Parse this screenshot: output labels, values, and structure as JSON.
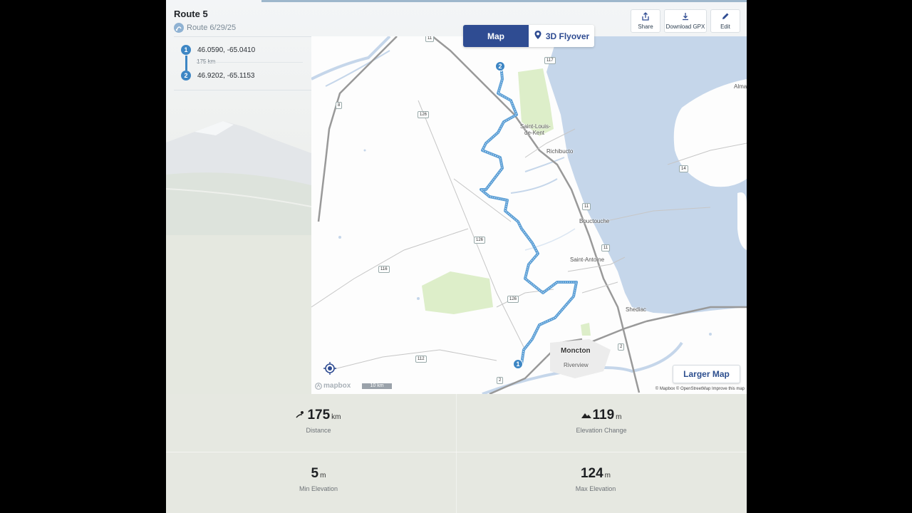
{
  "route": {
    "title": "Route 5",
    "subtitle": "Route 6/29/25"
  },
  "waypoints": [
    {
      "number": "1",
      "coord": "46.0590, -65.0410"
    },
    {
      "number": "2",
      "coord": "46.9202, -65.1153"
    }
  ],
  "segment_distance": "175 km",
  "view_toggle": {
    "map_label": "Map",
    "flyover_label": "3D Flyover",
    "active": "Map"
  },
  "actions": {
    "share": "Share",
    "download": "Download GPX",
    "edit": "Edit"
  },
  "map": {
    "places": {
      "saint_louis_1": "Saint-Louis-",
      "saint_louis_2": "de-Kent",
      "richibucto": "Richibucto",
      "bouctouche": "Bouctouche",
      "saint_antoine": "Saint-Antoine",
      "shediac": "Shediac",
      "moncton": "Moncton",
      "riverview": "Riverview",
      "alma": "Alma"
    },
    "shields": [
      "11",
      "117",
      "8",
      "126",
      "14",
      "11",
      "11",
      "126",
      "116",
      "126",
      "2",
      "112",
      "2"
    ],
    "logo": "mapbox",
    "scale": "10 km",
    "attribution": "© Mapbox © OpenStreetMap  Improve this map",
    "larger_map": "Larger Map",
    "colors": {
      "water": "#c5d6ea",
      "park": "#ddeec9",
      "route": "#5c9fd6",
      "pin": "#3d86c4"
    }
  },
  "stats": {
    "distance": {
      "value": "175",
      "unit": "km",
      "label": "Distance"
    },
    "elevation_change": {
      "value": "119",
      "unit": "m",
      "label": "Elevation Change"
    },
    "min_elevation": {
      "value": "5",
      "unit": "m",
      "label": "Min Elevation"
    },
    "max_elevation": {
      "value": "124",
      "unit": "m",
      "label": "Max Elevation"
    }
  }
}
